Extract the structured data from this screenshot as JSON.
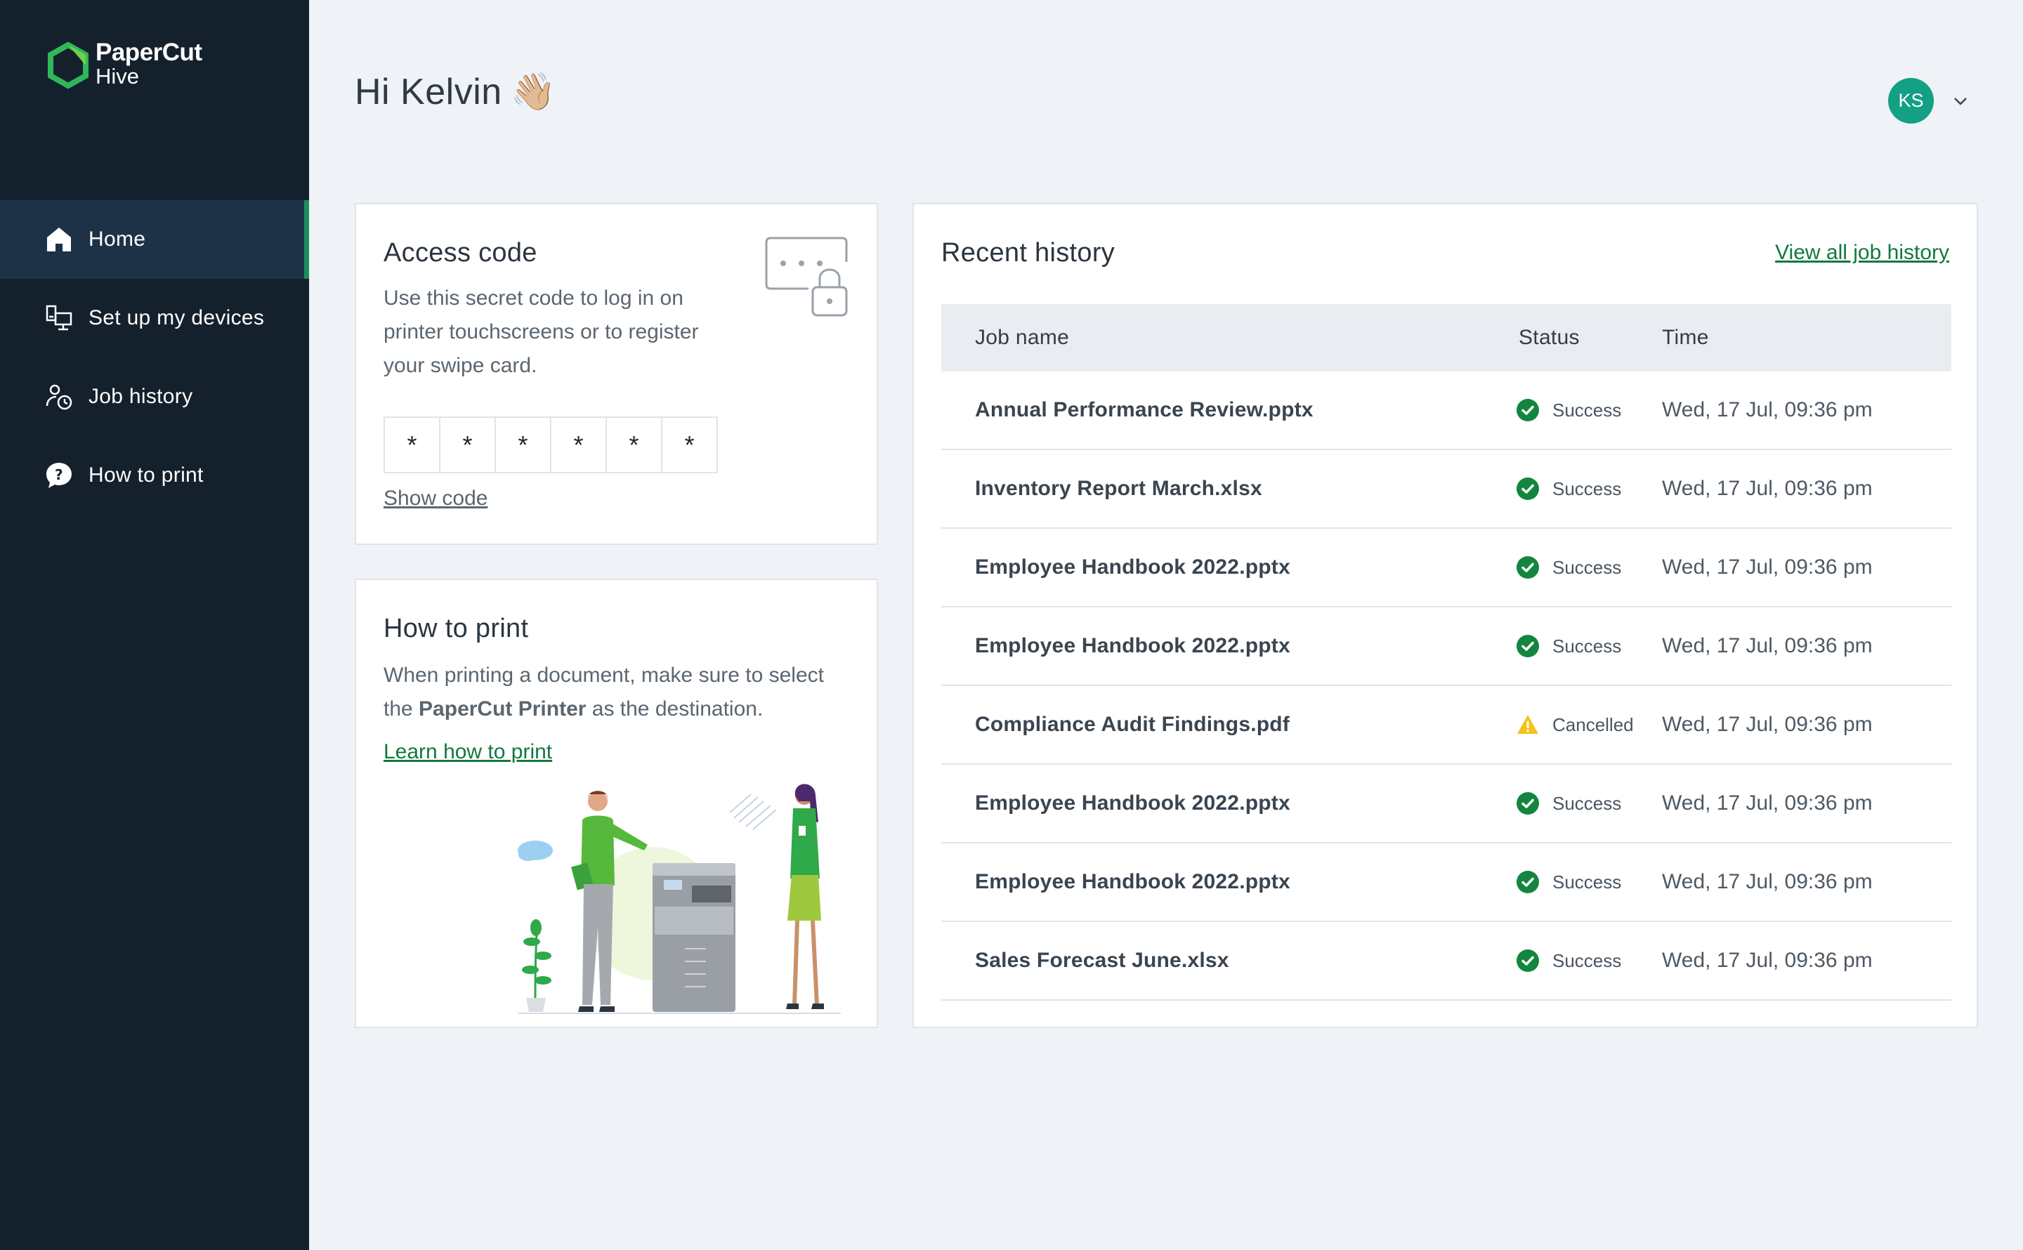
{
  "brand": {
    "line1": "PaperCut",
    "line2": "Hive"
  },
  "sidebar": {
    "items": [
      {
        "label": "Home",
        "icon": "home-icon",
        "active": true
      },
      {
        "label": "Set up my devices",
        "icon": "devices-icon",
        "active": false
      },
      {
        "label": "Job history",
        "icon": "job-history-icon",
        "active": false
      },
      {
        "label": "How to print",
        "icon": "help-icon",
        "active": false
      }
    ]
  },
  "header": {
    "greeting": "Hi Kelvin",
    "wave": "👋🏼",
    "avatar_initials": "KS"
  },
  "access_code": {
    "title": "Access code",
    "description": "Use this secret code to log in on printer touchscreens or to register your swipe card.",
    "digits": [
      "*",
      "*",
      "*",
      "*",
      "*",
      "*"
    ],
    "show_code": "Show code"
  },
  "how_to_print": {
    "title": "How to print",
    "desc_pre": "When printing a document, make sure to select the ",
    "desc_bold": "PaperCut Printer",
    "desc_post": " as the destination.",
    "link": "Learn how to print"
  },
  "recent_history": {
    "title": "Recent history",
    "view_all": "View all job history",
    "columns": [
      "Job name",
      "Status",
      "Time"
    ],
    "rows": [
      {
        "name": "Annual Performance Review.pptx",
        "status": "Success",
        "time": "Wed, 17 Jul, 09:36 pm"
      },
      {
        "name": "Inventory Report March.xlsx",
        "status": "Success",
        "time": "Wed, 17 Jul, 09:36 pm"
      },
      {
        "name": "Employee Handbook 2022.pptx",
        "status": "Success",
        "time": "Wed, 17 Jul, 09:36 pm"
      },
      {
        "name": "Employee Handbook 2022.pptx",
        "status": "Success",
        "time": "Wed, 17 Jul, 09:36 pm"
      },
      {
        "name": "Compliance Audit Findings.pdf",
        "status": "Cancelled",
        "time": "Wed, 17 Jul, 09:36 pm"
      },
      {
        "name": "Employee Handbook 2022.pptx",
        "status": "Success",
        "time": "Wed, 17 Jul, 09:36 pm"
      },
      {
        "name": "Employee Handbook 2022.pptx",
        "status": "Success",
        "time": "Wed, 17 Jul, 09:36 pm"
      },
      {
        "name": "Sales Forecast June.xlsx",
        "status": "Success",
        "time": "Wed, 17 Jul, 09:36 pm"
      }
    ]
  },
  "colors": {
    "sidebar_bg": "#15202d",
    "active_indicator": "#1a8f5e",
    "link_green": "#13783f",
    "success_green": "#13853f",
    "warning_yellow": "#f5c21b",
    "avatar_bg": "#13a085"
  }
}
